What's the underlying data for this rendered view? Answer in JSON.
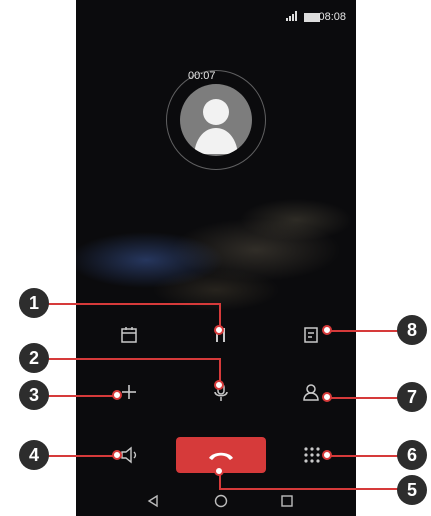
{
  "status_bar": {
    "time": "08:08"
  },
  "call": {
    "duration": "00:07"
  },
  "actions": {
    "hold": "hold",
    "notes": "notes",
    "mute": "mute",
    "add_call": "add call",
    "contacts": "contacts",
    "speaker": "speaker",
    "keypad": "keypad",
    "end_call": "end call",
    "calendar": "calendar"
  },
  "callouts": [
    "1",
    "2",
    "3",
    "4",
    "5",
    "6",
    "7",
    "8"
  ],
  "colors": {
    "accent": "#d63a3a",
    "badge": "#2d2d2d",
    "phone_bg": "#0b0b0d"
  }
}
